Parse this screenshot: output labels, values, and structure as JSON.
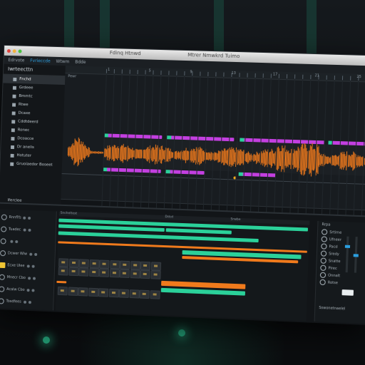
{
  "window": {
    "title_left": "Fdinq Htnwd",
    "title_right": "Mtrer Nmwkrd Tuimo"
  },
  "toolbar": {
    "items": [
      "Edrvote",
      "Fvrieccde",
      "Wtwm",
      "Bdde"
    ]
  },
  "sidebar": {
    "header": "Iwrteecttn",
    "items": [
      {
        "label": "Fnchd",
        "selected": true
      },
      {
        "label": "Grdeee",
        "selected": false
      },
      {
        "label": "Bmmtc",
        "selected": false
      },
      {
        "label": "Rtwe",
        "selected": false
      },
      {
        "label": "Dcaxe",
        "selected": false
      },
      {
        "label": "Cddtdeerd",
        "selected": false
      },
      {
        "label": "Ronec",
        "selected": false
      },
      {
        "label": "Dcoacce",
        "selected": false
      },
      {
        "label": "Dr anelis",
        "selected": false
      },
      {
        "label": "Hotuter",
        "selected": false
      },
      {
        "label": "Gruoiaedor Boseet",
        "selected": false
      }
    ],
    "bottom_label": "Iferclee"
  },
  "arrangement": {
    "label": "Pewr",
    "ruler_labels": [
      "1",
      "5",
      "9",
      "13",
      "17",
      "21",
      "25"
    ]
  },
  "lower": {
    "tracks": [
      {
        "name": "Rnnflfs",
        "icon": "circle"
      },
      {
        "name": "Tuadec",
        "icon": "circle"
      },
      {
        "name": "",
        "icon": "circle"
      },
      {
        "name": "Dcwer Wiw",
        "icon": "circle"
      },
      {
        "name": "Ecxe Ulee",
        "icon": "yellow"
      },
      {
        "name": "Mnecr Cbo",
        "icon": "circle"
      },
      {
        "name": "Acalw Cbo",
        "icon": "circle"
      },
      {
        "name": "Tosdfees",
        "icon": "circle"
      }
    ],
    "clip_headers": [
      "Sncheltest",
      "Ddcd",
      "Srwbe"
    ],
    "right_panel": {
      "header": "Rrpa",
      "rows": [
        "Srtirne",
        "Ufneer",
        "Pacd",
        "Sredy",
        "Snatte",
        "Pirec",
        "Onnalt",
        "Rotse"
      ],
      "footer": "Sswonetnaelel"
    }
  },
  "colors": {
    "accent_orange": "#f07a1c",
    "accent_green": "#2bd19a",
    "accent_magenta": "#c33fe0",
    "accent_blue": "#2b9fe0"
  }
}
